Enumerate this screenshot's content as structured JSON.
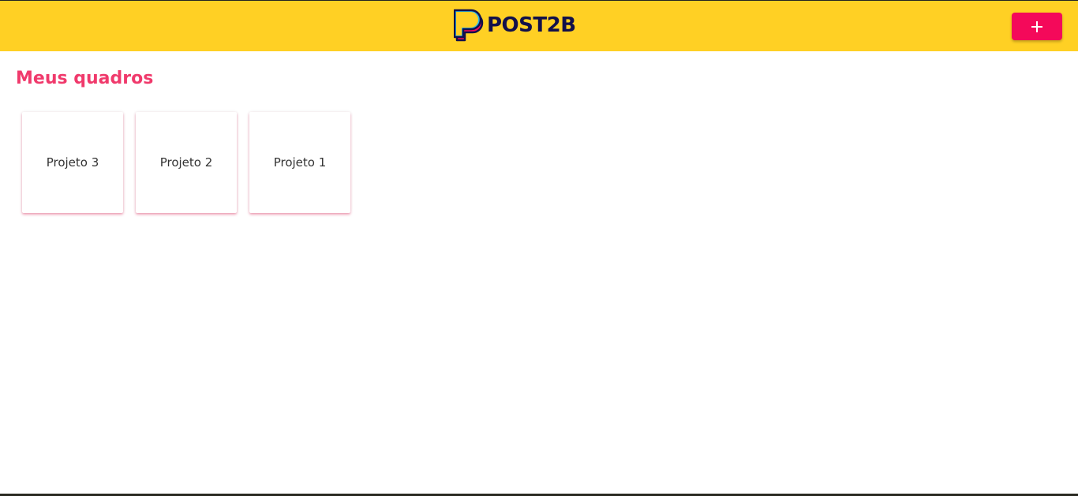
{
  "header": {
    "logo_text": "POST2B",
    "add_button_label": "+"
  },
  "main": {
    "title": "Meus quadros",
    "boards": [
      {
        "label": "Projeto 3"
      },
      {
        "label": "Projeto 2"
      },
      {
        "label": "Projeto 1"
      }
    ]
  },
  "colors": {
    "header_bg": "#FFD024",
    "brand_navy": "#12104A",
    "accent_pink": "#F4095A",
    "title_pink": "#F03A6C"
  },
  "icons": {
    "logo": "post2b-logo-icon",
    "add": "plus-icon"
  }
}
